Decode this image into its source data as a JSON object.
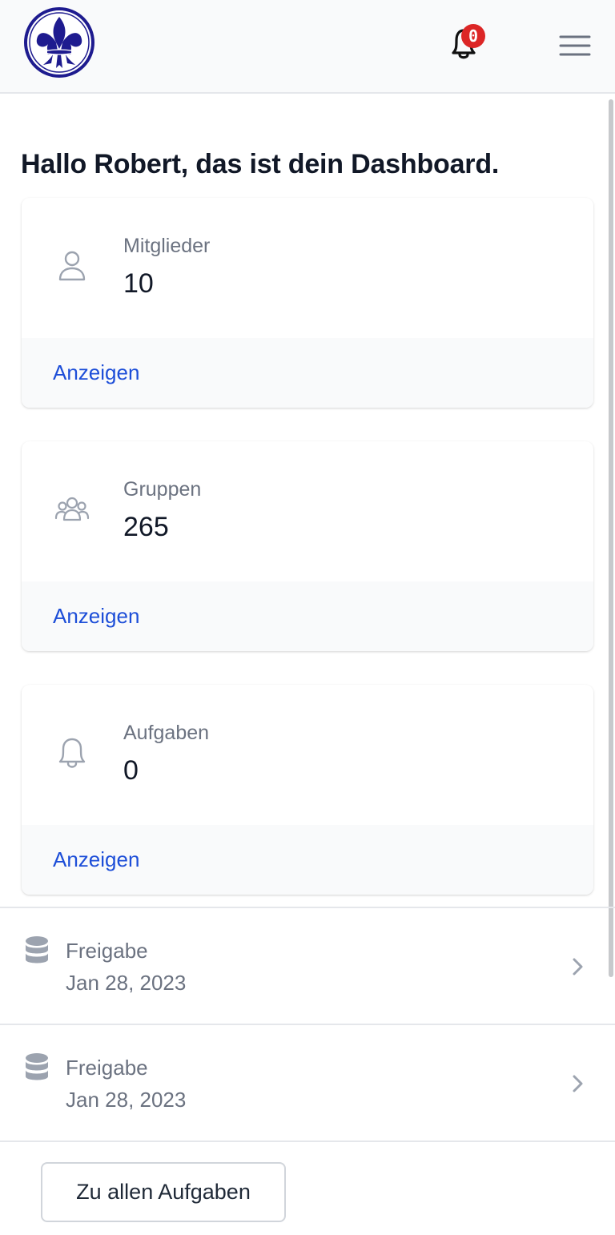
{
  "header": {
    "logo_name": "fleur-de-lis-logo",
    "notification_count": "0",
    "menu_icon": "hamburger-menu-icon"
  },
  "dashboard": {
    "greeting": "Hallo Robert, das ist dein Dashboard."
  },
  "cards": [
    {
      "icon": "user-icon",
      "label": "Mitglieder",
      "value": "10",
      "link": "Anzeigen"
    },
    {
      "icon": "user-group-icon",
      "label": "Gruppen",
      "value": "265",
      "link": "Anzeigen"
    },
    {
      "icon": "bell-icon",
      "label": "Aufgaben",
      "value": "0",
      "link": "Anzeigen"
    }
  ],
  "tasks": [
    {
      "icon": "database-icon",
      "title": "Freigabe",
      "date": "Jan 28, 2023"
    },
    {
      "icon": "database-icon",
      "title": "Freigabe",
      "date": "Jan 28, 2023"
    }
  ],
  "all_tasks_button": "Zu allen Aufgaben",
  "colors": {
    "link": "#1d4ed8",
    "badge": "#dc2626",
    "logo": "#1e1b8f",
    "muted_text": "#6b7280"
  }
}
